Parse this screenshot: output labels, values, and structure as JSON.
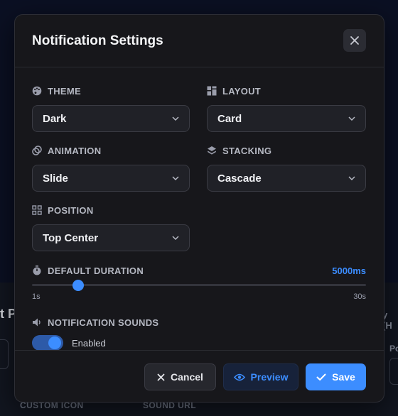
{
  "background": {
    "left_fragment": "t P",
    "right_fragment": "y (H",
    "right_p": "Po",
    "labels": [
      "CUSTOM ICON",
      "SOUND URL"
    ]
  },
  "modal": {
    "title": "Notification Settings",
    "close_icon": "close-icon",
    "fields": {
      "theme": {
        "label": "THEME",
        "value": "Dark",
        "icon": "palette-icon"
      },
      "layout": {
        "label": "LAYOUT",
        "value": "Card",
        "icon": "layout-icon"
      },
      "animation": {
        "label": "ANIMATION",
        "value": "Slide",
        "icon": "animation-icon"
      },
      "stacking": {
        "label": "STACKING",
        "value": "Cascade",
        "icon": "layers-icon"
      },
      "position": {
        "label": "POSITION",
        "value": "Top Center",
        "icon": "grid-icon"
      }
    },
    "duration": {
      "label": "DEFAULT DURATION",
      "value_text": "5000ms",
      "value": 5000,
      "min": 1000,
      "max": 30000,
      "min_label": "1s",
      "max_label": "30s",
      "icon": "timer-icon"
    },
    "sounds": {
      "label": "NOTIFICATION SOUNDS",
      "state": "Enabled",
      "enabled": true,
      "icon": "speaker-icon"
    },
    "footer": {
      "cancel": "Cancel",
      "preview": "Preview",
      "save": "Save"
    }
  },
  "colors": {
    "accent": "#3c8dff",
    "modal_bg": "#17171b",
    "select_bg": "#202127"
  }
}
